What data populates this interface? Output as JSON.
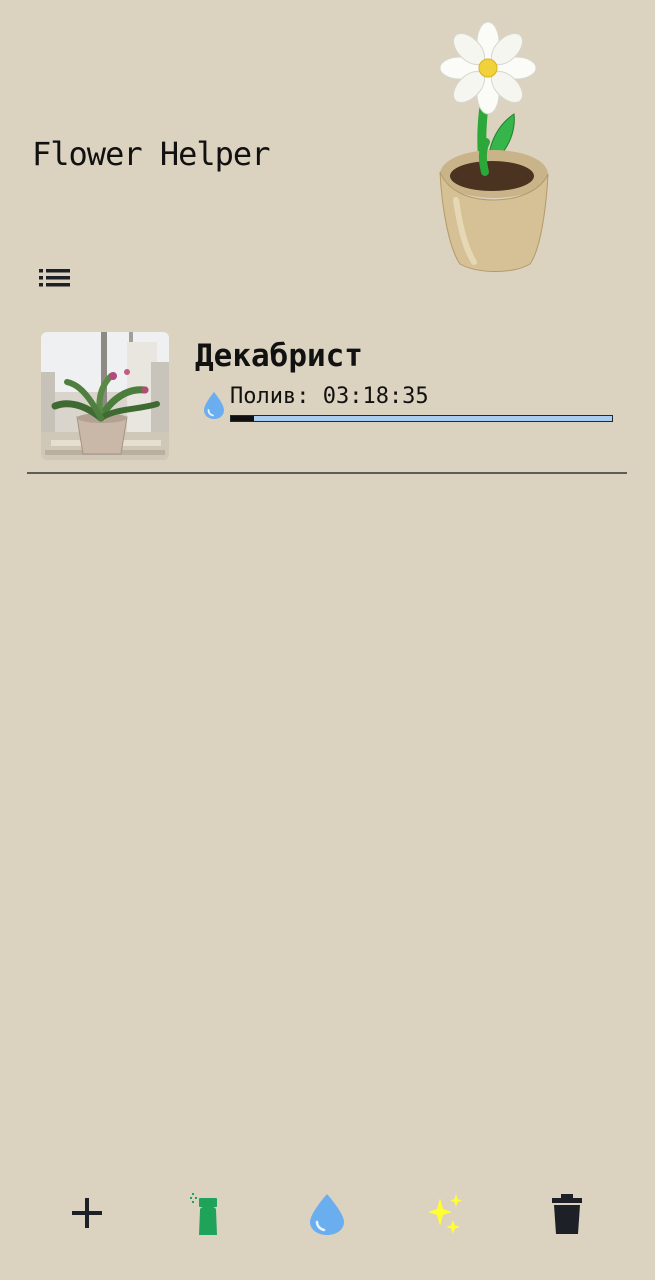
{
  "app": {
    "title": "Flower Helper"
  },
  "header": {
    "illustration_icon": "potted-daisy-icon",
    "menu_icon": "list-menu-icon"
  },
  "plants": [
    {
      "name": "Декабрист",
      "photo_icon": "plant-photo",
      "status_icon": "water-drop-icon",
      "water_status": "Полив: 03:18:35",
      "water_progress": 0.06
    }
  ],
  "bottom_bar": {
    "buttons": [
      {
        "icon": "plus-icon"
      },
      {
        "icon": "spray-bottle-icon"
      },
      {
        "icon": "water-drop-icon"
      },
      {
        "icon": "sparkles-icon"
      },
      {
        "icon": "trash-icon"
      }
    ]
  },
  "colors": {
    "background": "#dbd2c0",
    "water_blue": "#6aaef0",
    "spray_green": "#1fa25a",
    "sparkle_yellow": "#ffff33",
    "divider": "#5f5c58",
    "progress_track": "#a8cdf0"
  }
}
